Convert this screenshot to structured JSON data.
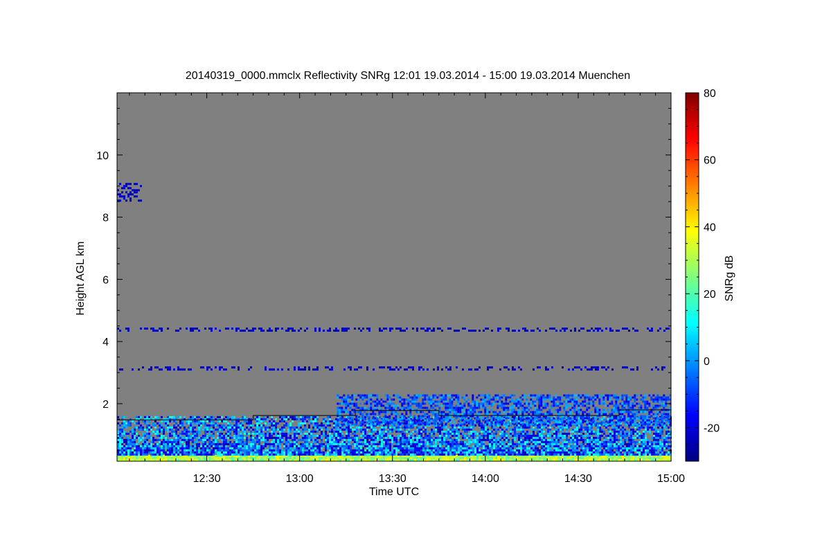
{
  "chart_data": {
    "type": "heatmap",
    "title": "20140319_0000.mmclx Reflectivity SNRg   12:01 19.03.2014 - 15:00 19.03.2014 Muenchen",
    "xlabel": "Time UTC",
    "ylabel": "Height AGL km",
    "colorbar_label": "SNRg dB",
    "x_time_range": [
      "12:01",
      "15:00"
    ],
    "xlim_hours": [
      12.0167,
      15.0
    ],
    "ylim": [
      0.15,
      12.0
    ],
    "clim": [
      -30,
      80
    ],
    "x_ticks": [
      {
        "label": "12:30",
        "value": 12.5
      },
      {
        "label": "13:00",
        "value": 13.0
      },
      {
        "label": "13:30",
        "value": 13.5
      },
      {
        "label": "14:00",
        "value": 14.0
      },
      {
        "label": "14:30",
        "value": 14.5
      },
      {
        "label": "15:00",
        "value": 15.0
      }
    ],
    "y_ticks": [
      {
        "label": "2",
        "value": 2
      },
      {
        "label": "4",
        "value": 4
      },
      {
        "label": "6",
        "value": 6
      },
      {
        "label": "8",
        "value": 8
      },
      {
        "label": "10",
        "value": 10
      }
    ],
    "colorbar_ticks": [
      {
        "label": "-20",
        "value": -20
      },
      {
        "label": "0",
        "value": 0
      },
      {
        "label": "20",
        "value": 20
      },
      {
        "label": "40",
        "value": 40
      },
      {
        "label": "60",
        "value": 60
      },
      {
        "label": "80",
        "value": 80
      }
    ],
    "no_signal_color": "#808080",
    "colormap": [
      "#00007f",
      "#0000ff",
      "#007fff",
      "#00ffff",
      "#7fff7f",
      "#ffff00",
      "#ff7f00",
      "#ff0000",
      "#7f0000"
    ],
    "series": [
      {
        "kind": "line",
        "color": "#000000",
        "points": [
          [
            12.0167,
            1.48
          ],
          [
            12.75,
            1.48
          ],
          [
            12.75,
            1.62
          ],
          [
            13.3,
            1.62
          ],
          [
            13.3,
            1.78
          ],
          [
            13.75,
            1.78
          ],
          [
            13.75,
            1.62
          ],
          [
            14.72,
            1.62
          ],
          [
            14.72,
            1.8
          ],
          [
            15.0,
            1.8
          ]
        ]
      }
    ],
    "echo_layers": [
      {
        "name": "surface clutter",
        "x": [
          12.0167,
          15.0
        ],
        "y": [
          0.15,
          0.35
        ],
        "snr_db": [
          20,
          40
        ]
      },
      {
        "name": "boundary layer",
        "x": [
          12.0167,
          15.0
        ],
        "y": [
          0.35,
          1.6
        ],
        "snr_db": [
          -25,
          15
        ]
      },
      {
        "name": "cloud layer",
        "x": [
          13.2,
          15.0
        ],
        "y": [
          1.3,
          2.3
        ],
        "snr_db": [
          -20,
          5
        ]
      },
      {
        "name": "range gate artifact 3.15 km",
        "x": [
          12.0167,
          15.0
        ],
        "y": [
          3.1,
          3.2
        ],
        "snr_db": [
          -25,
          -20
        ]
      },
      {
        "name": "range gate artifact 4.4 km",
        "x": [
          12.0167,
          15.0
        ],
        "y": [
          4.35,
          4.45
        ],
        "snr_db": [
          -25,
          -20
        ]
      },
      {
        "name": "sparse echo 9 km",
        "x": [
          12.0167,
          12.15
        ],
        "y": [
          8.55,
          9.1
        ],
        "snr_db": [
          -25,
          -20
        ]
      }
    ]
  }
}
